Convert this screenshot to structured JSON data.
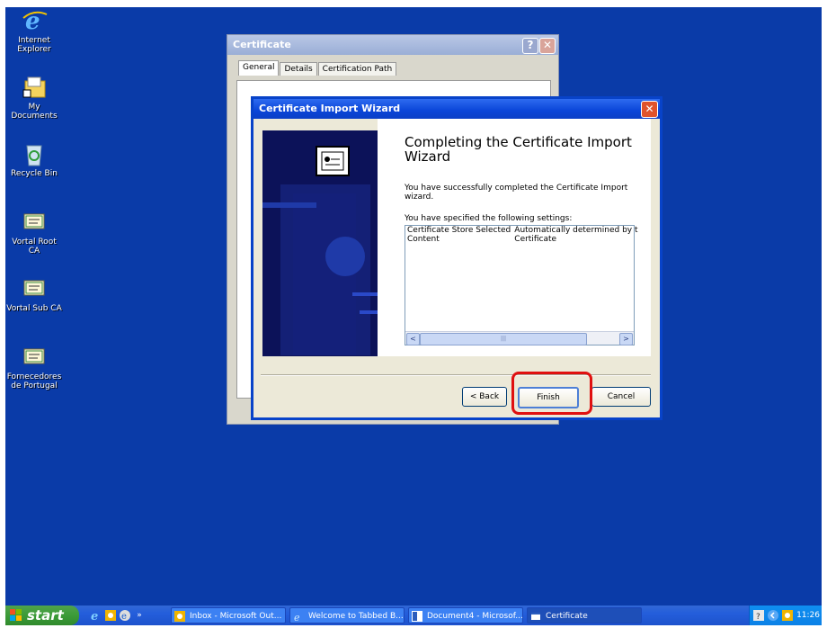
{
  "desktop_icons": [
    {
      "label": "Internet\nExplorer",
      "icon": "ie-icon"
    },
    {
      "label": "My Documents",
      "icon": "my-documents-icon"
    },
    {
      "label": "Recycle Bin",
      "icon": "recycle-bin-icon"
    },
    {
      "label": "Vortal Root CA",
      "icon": "certificate-icon"
    },
    {
      "label": "Vortal Sub CA",
      "icon": "certificate-icon"
    },
    {
      "label": "Fornecedores\nde Portugal",
      "icon": "certificate-icon"
    }
  ],
  "certificate_window": {
    "title": "Certificate",
    "help_label": "?",
    "close_label": "✕",
    "tabs": [
      "General",
      "Details",
      "Certification Path"
    ]
  },
  "wizard": {
    "title": "Certificate Import Wizard",
    "close_label": "✕",
    "heading": "Completing the Certificate Import Wizard",
    "success_text": "You have successfully completed the Certificate Import wizard.",
    "settings_label": "You have specified the following settings:",
    "settings": [
      {
        "name": "Certificate Store Selected",
        "value": "Automatically determined by t"
      },
      {
        "name": "Content",
        "value": "Certificate"
      }
    ],
    "scroll_left": "<",
    "scroll_right": ">",
    "scroll_grip": "|||",
    "buttons": {
      "back": "< Back",
      "finish": "Finish",
      "cancel": "Cancel"
    }
  },
  "taskbar": {
    "start_label": "start",
    "quick_launch_more": "»",
    "tasks": [
      {
        "label": "Inbox - Microsoft Out...",
        "icon": "outlook-icon"
      },
      {
        "label": "Welcome to Tabbed B...",
        "icon": "ie-icon"
      },
      {
        "label": "Document4 - Microsof...",
        "icon": "word-icon"
      },
      {
        "label": "Certificate",
        "icon": "window-icon"
      }
    ],
    "clock": "11:26"
  },
  "colors": {
    "desktop": "#0a3ba8",
    "wizard_titlebar": "#0a45d8",
    "highlight_box": "#e01010",
    "start_button": "#3c9b38"
  }
}
